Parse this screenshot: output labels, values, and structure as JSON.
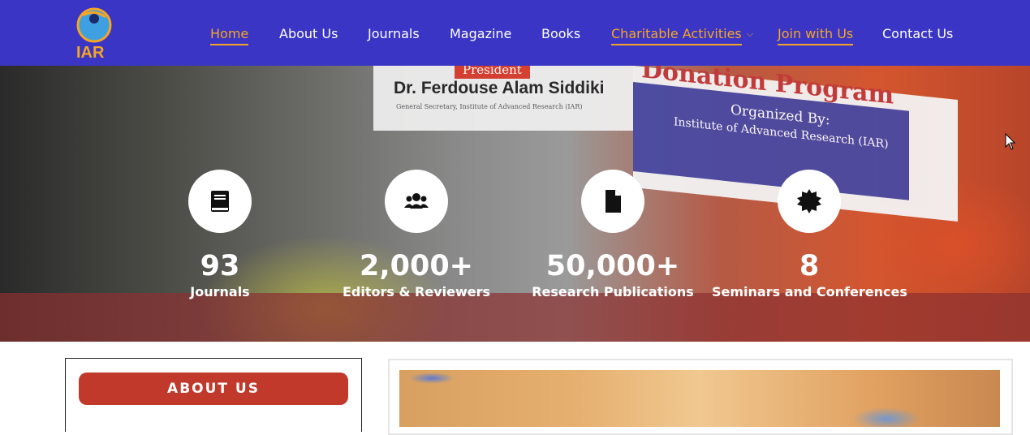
{
  "nav": {
    "logo_text": "IAR",
    "items": [
      {
        "label": "Home",
        "active": true
      },
      {
        "label": "About Us",
        "active": false
      },
      {
        "label": "Journals",
        "active": false
      },
      {
        "label": "Magazine",
        "active": false
      },
      {
        "label": "Books",
        "active": false
      },
      {
        "label": "Charitable Activities",
        "active": true,
        "has_dropdown": true
      },
      {
        "label": "Join with Us",
        "active": true
      },
      {
        "label": "Contact Us",
        "active": false
      }
    ]
  },
  "hero": {
    "banner_left": {
      "tag": "President",
      "name": "Dr. Ferdouse Alam Siddiki",
      "sub": "General Secretary, Institute of Advanced Research (IAR)"
    },
    "banner_right": {
      "title": "Donation Program",
      "organized_by": "Organized By:",
      "org": "Institute of Advanced Research (IAR)"
    },
    "stats": [
      {
        "icon": "book-icon",
        "value": "93",
        "label": "Journals"
      },
      {
        "icon": "users-icon",
        "value": "2,000+",
        "label": "Editors & Reviewers"
      },
      {
        "icon": "file-icon",
        "value": "50,000+",
        "label": "Research Publications"
      },
      {
        "icon": "badge-icon",
        "value": "8",
        "label": "Seminars and Conferences"
      }
    ]
  },
  "about": {
    "button_label": "ABOUT US"
  },
  "colors": {
    "nav_bg": "#3a35c4",
    "accent": "#f5a623",
    "button_red": "#c0392b"
  }
}
